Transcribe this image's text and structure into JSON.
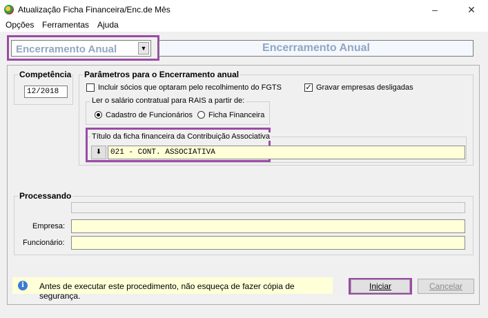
{
  "window": {
    "title": "Atualização Ficha Financeira/Enc.de Mês",
    "controls": {
      "minimize": "–",
      "maximize": "☐",
      "close": "✕"
    }
  },
  "menu": {
    "items": [
      {
        "label": "Opções"
      },
      {
        "label": "Ferramentas"
      },
      {
        "label": "Ajuda"
      }
    ]
  },
  "header": {
    "mode_select": {
      "value": "Encerramento Anual"
    },
    "banner_title": "Encerramento Anual"
  },
  "competencia": {
    "title": "Competência",
    "value": "12/2018"
  },
  "parametros": {
    "title": "Parâmetros para o Encerramento anual",
    "incluir_socios": {
      "label": "Incluir sócios que optaram pelo recolhimento do FGTS",
      "checked": false
    },
    "gravar_desligadas": {
      "label": "Gravar empresas desligadas",
      "checked": true
    },
    "rais": {
      "title": "Ler o salário contratual para RAIS a partir de:",
      "option_cadastro": "Cadastro de Funcionários",
      "option_ficha": "Ficha Financeira",
      "selected": "Cadastro de Funcionários"
    },
    "titulo_ficha": {
      "title": "Título da ficha financeira da Contribuição Associativa",
      "value": "021 - CONT. ASSOCIATIVA"
    }
  },
  "processando": {
    "title": "Processando",
    "progress": 0,
    "empresa_label": "Empresa:",
    "empresa_value": "",
    "funcionario_label": "Funcionário:",
    "funcionario_value": ""
  },
  "footer": {
    "info_text": "Antes de executar este procedimento, não esqueça de fazer cópia de segurança.",
    "iniciar_label": "Iniciar",
    "cancelar_label": "Cancelar"
  },
  "colors": {
    "highlight": "#9b4aa6",
    "banner_text": "#8fa7c5",
    "field_yellow": "#ffffd8"
  }
}
